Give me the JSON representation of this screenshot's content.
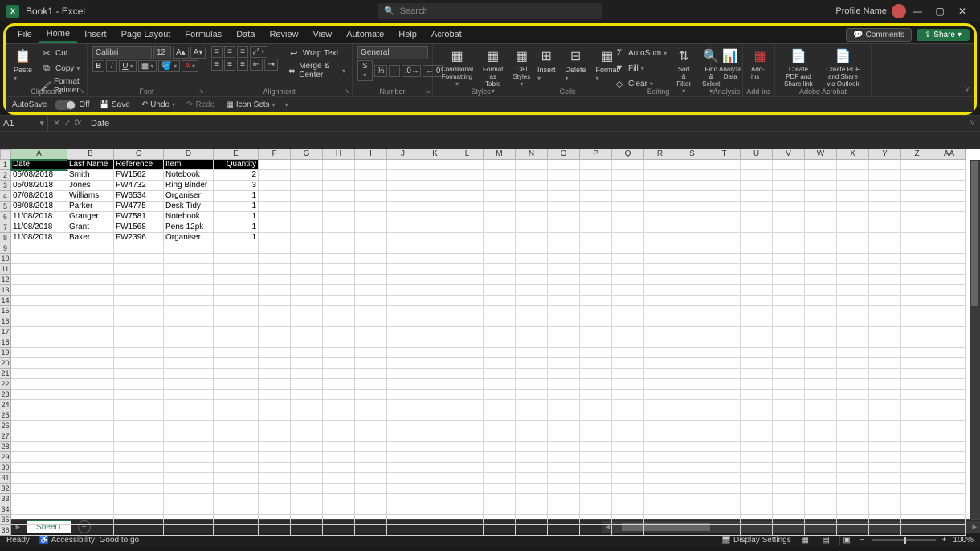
{
  "title": {
    "doc": "Book1",
    "app": "Excel"
  },
  "search": {
    "placeholder": "Search"
  },
  "profile": {
    "name": "Profile Name"
  },
  "menu": {
    "file": "File",
    "home": "Home",
    "insert": "Insert",
    "pagelayout": "Page Layout",
    "formulas": "Formulas",
    "data": "Data",
    "review": "Review",
    "view": "View",
    "automate": "Automate",
    "help": "Help",
    "acrobat": "Acrobat"
  },
  "topbtns": {
    "comments": "Comments",
    "share": "Share"
  },
  "ribbon": {
    "clipboard": {
      "paste": "Paste",
      "cut": "Cut",
      "copy": "Copy",
      "fmtpainter": "Format Painter",
      "label": "Clipboard"
    },
    "font": {
      "name": "Calibri",
      "size": "12",
      "label": "Font"
    },
    "alignment": {
      "wrap": "Wrap Text",
      "merge": "Merge & Center",
      "label": "Alignment"
    },
    "number": {
      "fmt": "General",
      "label": "Number"
    },
    "styles": {
      "cond": "Conditional Formatting",
      "table": "Format as Table",
      "cell": "Cell Styles",
      "label": "Styles"
    },
    "cells": {
      "insert": "Insert",
      "delete": "Delete",
      "format": "Format",
      "label": "Cells"
    },
    "editing": {
      "autosum": "AutoSum",
      "fill": "Fill",
      "clear": "Clear",
      "sort": "Sort & Filter",
      "find": "Find & Select",
      "label": "Editing"
    },
    "analysis": {
      "analyze": "Analyze Data",
      "label": "Analysis"
    },
    "addins": {
      "addins": "Add-ins",
      "label": "Add-ins"
    },
    "adobe": {
      "createshare": "Create PDF and Share link",
      "createoutlook": "Create PDF and Share via Outlook",
      "label": "Adobe Acrobat"
    }
  },
  "qat": {
    "autosave": "AutoSave",
    "off": "Off",
    "save": "Save",
    "undo": "Undo",
    "redo": "Redo",
    "iconsets": "Icon Sets"
  },
  "formula": {
    "ref": "A1",
    "value": "Date"
  },
  "columns": [
    "A",
    "B",
    "C",
    "D",
    "E",
    "F",
    "G",
    "H",
    "I",
    "J",
    "K",
    "L",
    "M",
    "N",
    "O",
    "P",
    "Q",
    "R",
    "S",
    "T",
    "U",
    "V",
    "W",
    "X",
    "Y",
    "Z",
    "AA"
  ],
  "colwidths": {
    "A": 70,
    "B": 58,
    "C": 62,
    "D": 62,
    "E": 56,
    "default": 40
  },
  "headers": {
    "date": "Date",
    "lastname": "Last Name",
    "reference": "Reference",
    "item": "Item",
    "quantity": "Quantity"
  },
  "rows": [
    {
      "date": "05/08/2018",
      "lastname": "Smith",
      "reference": "FW1562",
      "item": "Notebook",
      "quantity": "2"
    },
    {
      "date": "05/08/2018",
      "lastname": "Jones",
      "reference": "FW4732",
      "item": "Ring Binder",
      "quantity": "3"
    },
    {
      "date": "07/08/2018",
      "lastname": "Williams",
      "reference": "FW6534",
      "item": "Organiser",
      "quantity": "1"
    },
    {
      "date": "08/08/2018",
      "lastname": "Parker",
      "reference": "FW4775",
      "item": "Desk Tidy",
      "quantity": "1"
    },
    {
      "date": "11/08/2018",
      "lastname": "Granger",
      "reference": "FW7581",
      "item": "Notebook",
      "quantity": "1"
    },
    {
      "date": "11/08/2018",
      "lastname": "Grant",
      "reference": "FW1568",
      "item": "Pens 12pk",
      "quantity": "1"
    },
    {
      "date": "11/08/2018",
      "lastname": "Baker",
      "reference": "FW2396",
      "item": "Organiser",
      "quantity": "1"
    }
  ],
  "totalrows": 36,
  "sheet": {
    "name": "Sheet1"
  },
  "status": {
    "ready": "Ready",
    "accessibility": "Accessibility: Good to go",
    "display": "Display Settings",
    "zoom": "100%"
  }
}
